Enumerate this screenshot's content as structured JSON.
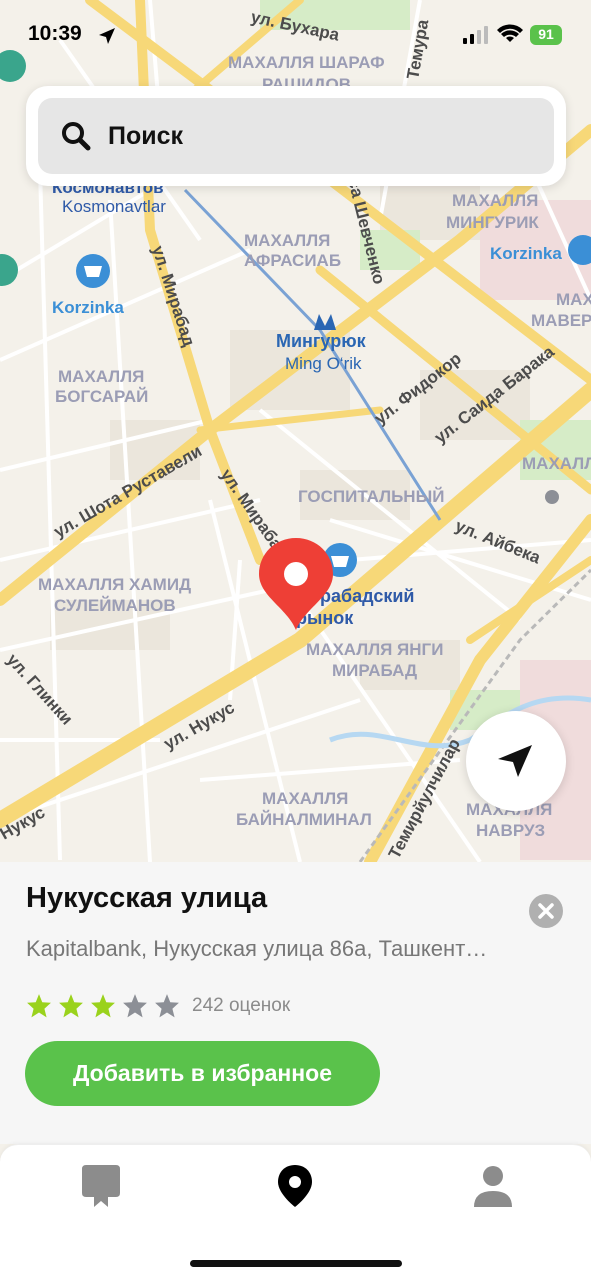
{
  "status": {
    "time": "10:39",
    "battery": "91"
  },
  "search": {
    "placeholder": "Поиск"
  },
  "map_labels": {
    "street_bukhara": "ул. Бухара",
    "mahalla_sharaf_1": "МАХАЛЛЯ ШАРАФ",
    "mahalla_sharaf_2": "РАШИДОВ",
    "temura": "Темура",
    "kosmonavtov": "Космонавтов",
    "kosmonavtlar": "Kosmonavtlar",
    "shevchenko": "са Шевченко",
    "mahalla_afrasiab_1": "МАХАЛЛЯ",
    "mahalla_afrasiab_2": "АФРАСИАБ",
    "mahalla_mingurik_1": "МАХАЛЛЯ",
    "mahalla_mingurik_2": "МИНГУРИК",
    "korzinka_right": "Korzinka",
    "korzinka_left": "Korzinka",
    "mirabad_street_top": "ул. Мирабад",
    "metro_name": "Мингурюк",
    "metro_name_latin": "Ming O‘rik",
    "mahalla_mavera_1": "МАХ",
    "mahalla_mavera_2": "МАВЕР",
    "mahalla_bogsaray_1": "МАХАЛЛЯ",
    "mahalla_bogsaray_2": "БОГСАРАЙ",
    "fidokor": "ул. Фидокор",
    "saida_baraka": "ул. Саида Барака",
    "shota_rustaveli": "ул. Шота Руставели",
    "mahalla_right": "МАХАЛЛ",
    "gospitalny": "ГОСПИТАЛЬНЫЙ",
    "mirabad_street_mid": "ул. Мираба",
    "aybeka": "ул. Айбека",
    "market_1": "рабадский",
    "market_2": "рынок",
    "mahalla_hamid_1": "МАХАЛЛЯ ХАМИД",
    "mahalla_hamid_2": "СУЛЕЙМАНОВ",
    "mahalla_yangi_1": "МАХАЛЛЯ ЯНГИ",
    "mahalla_yangi_2": "МИРАБАД",
    "glinki": "ул. Глинки",
    "nukus_main": "ул. Нукус",
    "nukus_left": "Нукус",
    "temiryulchilar": "Темирйулчилар",
    "mahalla_baynalminal_1": "МАХАЛЛЯ",
    "mahalla_baynalminal_2": "БАЙНАЛМИНАЛ",
    "mahalla_navruz_1": "МАХАЛЛЯ",
    "mahalla_navruz_2": "НАВРУЗ"
  },
  "place": {
    "title": "Нукусская улица",
    "address": "Kapitalbank, Нукусская улица 86а, Ташкент…",
    "rating_stars": 3,
    "rating_max": 5,
    "rating_count": "242 оценок",
    "favorite_button": "Добавить в избранное"
  },
  "colors": {
    "accent_green": "#5ac24b",
    "star_active": "#9ad21c",
    "star_inactive": "#8c8f96",
    "pin_red": "#ee3f36",
    "metro_blue": "#2a66b3",
    "korzinka_blue": "#3b8fd6"
  },
  "tabs": [
    "bookmarks",
    "map",
    "profile"
  ]
}
